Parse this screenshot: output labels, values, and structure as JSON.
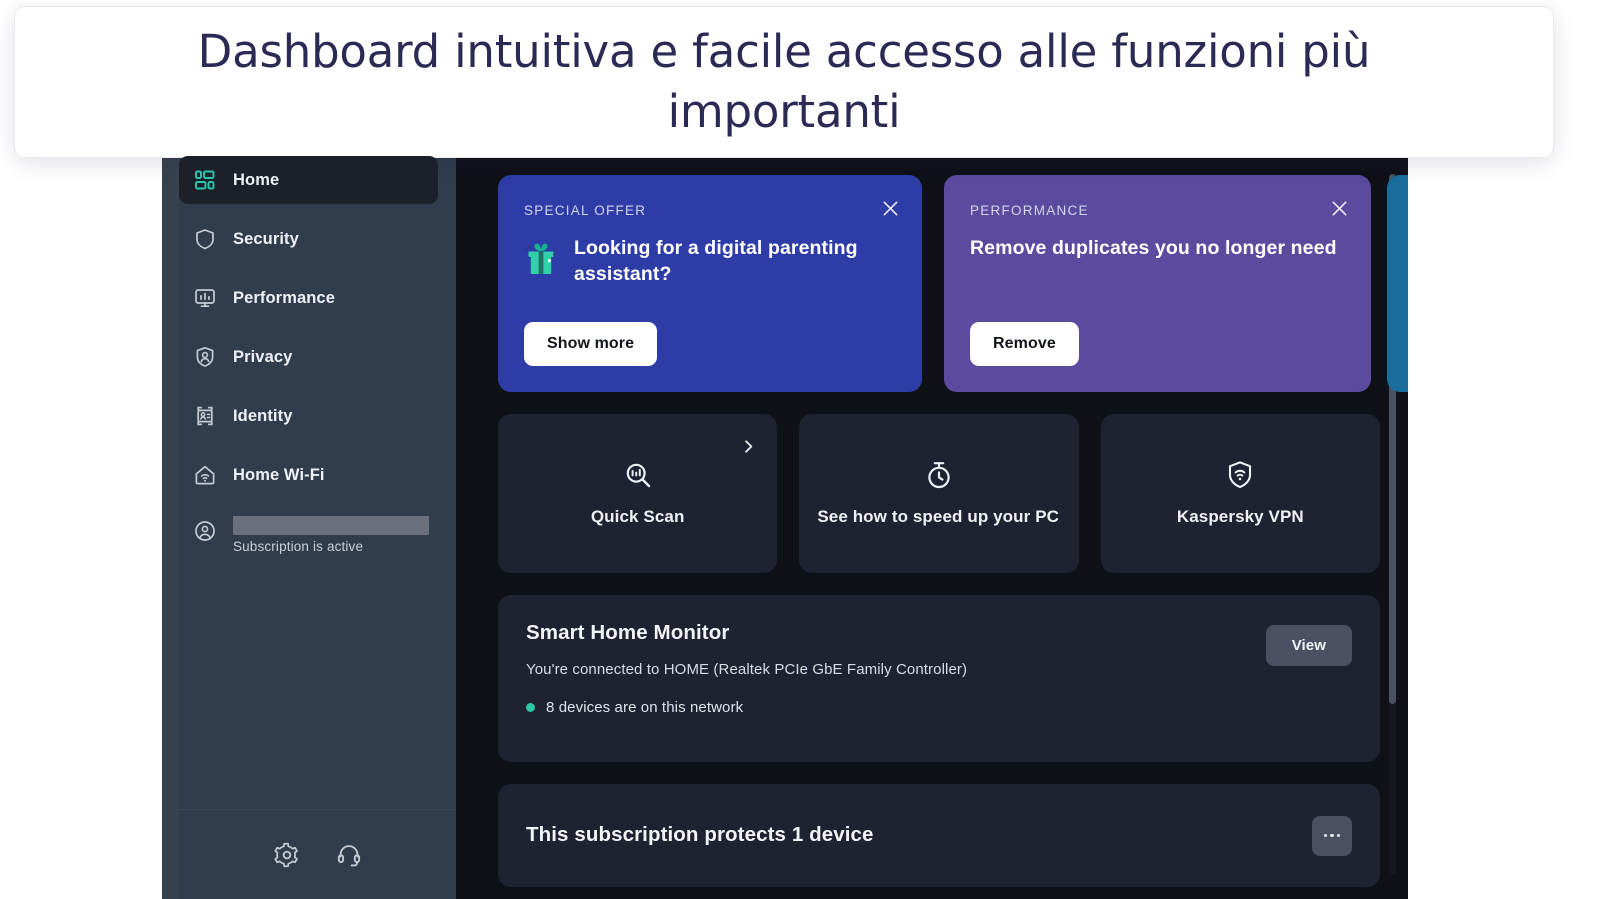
{
  "overlay": {
    "headline": "Dashboard intuitiva e facile accesso alle funzioni più importanti"
  },
  "sidebar": {
    "items": [
      {
        "label": "Home",
        "icon": "dashboard-icon",
        "active": true
      },
      {
        "label": "Security",
        "icon": "shield-icon",
        "active": false
      },
      {
        "label": "Performance",
        "icon": "monitor-icon",
        "active": false
      },
      {
        "label": "Privacy",
        "icon": "privacy-shield-icon",
        "active": false
      },
      {
        "label": "Identity",
        "icon": "id-card-icon",
        "active": false
      },
      {
        "label": "Home Wi-Fi",
        "icon": "home-wifi-icon",
        "active": false
      }
    ],
    "account": {
      "icon": "account-icon",
      "name_redacted": "",
      "status": "Subscription is active"
    },
    "footer": {
      "settings_icon": "gear-icon",
      "support_icon": "headset-icon"
    }
  },
  "banners": [
    {
      "kicker": "SPECIAL OFFER",
      "title": "Looking for a digital parenting assistant?",
      "button": "Show more",
      "icon": "gift-icon",
      "close_icon": "close-icon",
      "color": "#2e3ca8"
    },
    {
      "kicker": "PERFORMANCE",
      "title": "Remove duplicates you no longer need",
      "button": "Remove",
      "close_icon": "close-icon",
      "color": "#5b4a9e"
    }
  ],
  "tiles": [
    {
      "label": "Quick Scan",
      "icon": "scan-magnifier-icon",
      "chevron": "chevron-right-icon"
    },
    {
      "label": "See how to speed up your PC",
      "icon": "stopwatch-icon"
    },
    {
      "label": "Kaspersky VPN",
      "icon": "vpn-shield-icon"
    }
  ],
  "smart_home": {
    "title": "Smart Home Monitor",
    "subtitle": "You're connected to HOME (Realtek PCIe GbE Family Controller)",
    "status": "8 devices are on this network",
    "status_dot_color": "#2fc5a6",
    "button": "View"
  },
  "subscription": {
    "title": "This subscription protects 1 device",
    "more_button": "more-options-icon"
  },
  "colors": {
    "accent_teal": "#2fc5b0",
    "sidebar_bg": "#313c4c",
    "main_bg": "#0f1119",
    "card_bg": "#1f2230",
    "headline_text": "#2a2a55"
  }
}
